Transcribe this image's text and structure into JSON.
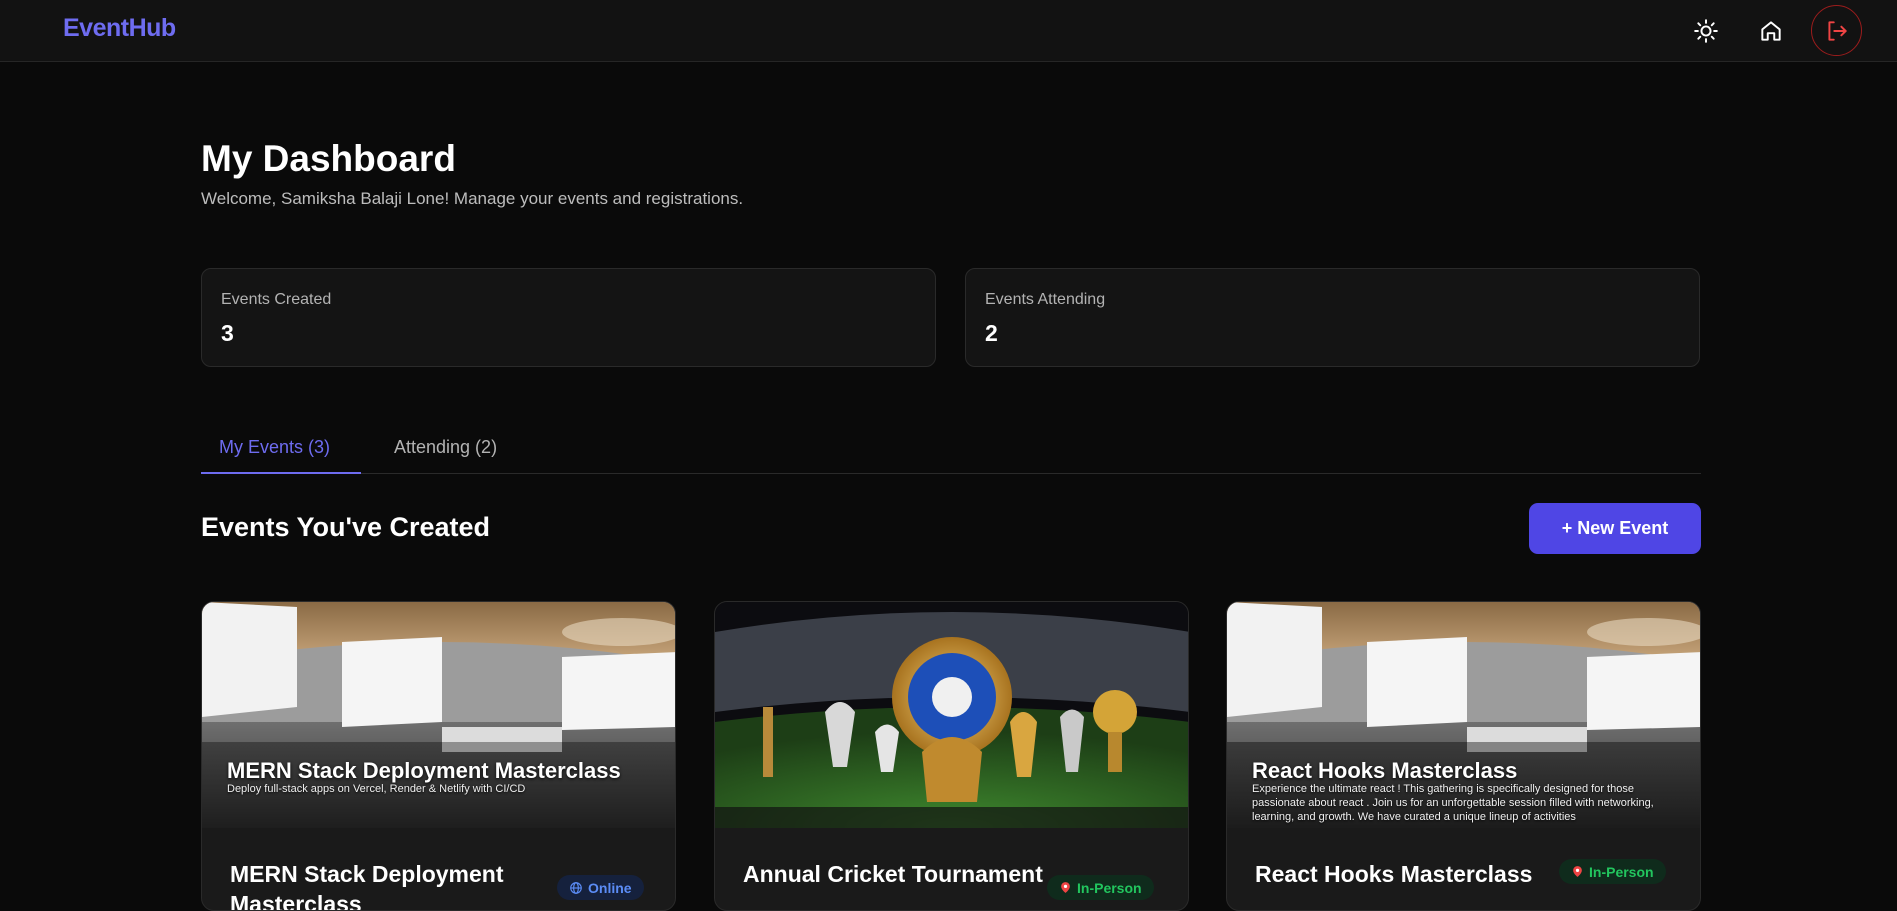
{
  "app": {
    "brand": "EventHub"
  },
  "header": {
    "icons": [
      "sun-icon",
      "home-icon",
      "logout-icon"
    ],
    "logout_color": "#ef4444"
  },
  "dashboard": {
    "title": "My Dashboard",
    "welcome": "Welcome, Samiksha Balaji Lone! Manage your events and registrations."
  },
  "stats": [
    {
      "label": "Events Created",
      "value": "3"
    },
    {
      "label": "Events Attending",
      "value": "2"
    }
  ],
  "tabs": [
    {
      "label": "My Events (3)",
      "active": true
    },
    {
      "label": "Attending (2)",
      "active": false
    }
  ],
  "section": {
    "title": "Events You've Created",
    "new_event_label": "+ New Event"
  },
  "events": [
    {
      "overlay_title": "MERN Stack Deployment Masterclass",
      "overlay_desc": "Deploy full-stack apps on Vercel, Render & Netlify with CI/CD",
      "title": "MERN Stack Deployment Masterclass",
      "badge": "Online",
      "badge_icon": "globe-icon"
    },
    {
      "overlay_title": "",
      "overlay_desc": "",
      "title": "Annual Cricket Tournament",
      "badge": "In-Person",
      "badge_icon": "pin-icon"
    },
    {
      "overlay_title": "React Hooks Masterclass",
      "overlay_desc": "Experience the ultimate react ! This gathering is specifically designed for those passionate about react . Join us for an unforgettable session filled with networking, learning, and growth. We have curated a unique lineup of activities",
      "title": "React Hooks Masterclass",
      "badge": "In-Person",
      "badge_icon": "pin-icon"
    }
  ],
  "colors": {
    "accent": "#6e6cf0",
    "button": "#4f46e5",
    "online": "#5b8cf5",
    "in_person": "#22c55e"
  }
}
